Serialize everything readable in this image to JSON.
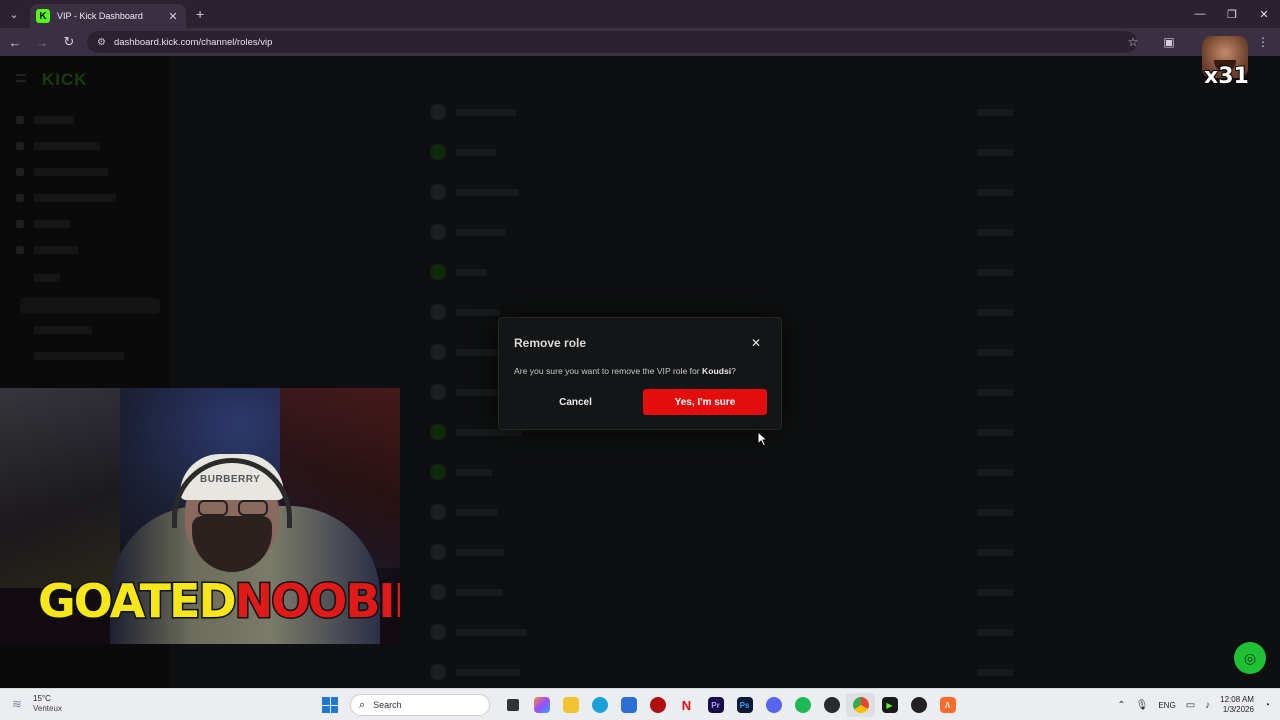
{
  "browser": {
    "tab_title": "VIP - Kick Dashboard",
    "tab_favicon": "K",
    "url": "dashboard.kick.com/channel/roles/vip"
  },
  "sidebar": {
    "logo": "KICK"
  },
  "modal": {
    "title": "Remove role",
    "message_prefix": "Are you sure you want to remove the VIP role for ",
    "username": "Koudsi",
    "message_suffix": "?",
    "cancel_label": "Cancel",
    "confirm_label": "Yes, I'm sure"
  },
  "overlay": {
    "cap_text": "BURBERRY",
    "title_part1": "GOATED",
    "title_part2": "NOOBIE",
    "reaction_count": "x31"
  },
  "taskbar": {
    "weather_temp": "15°C",
    "weather_desc": "Venteux",
    "search_placeholder": "Search",
    "language": "ENG",
    "time": "12:08 AM",
    "date": "1/3/2026"
  },
  "colors": {
    "kick_green": "#53fc18",
    "confirm_red": "#e30d0d",
    "title_yellow": "#f5e71a",
    "title_red": "#e01919"
  }
}
